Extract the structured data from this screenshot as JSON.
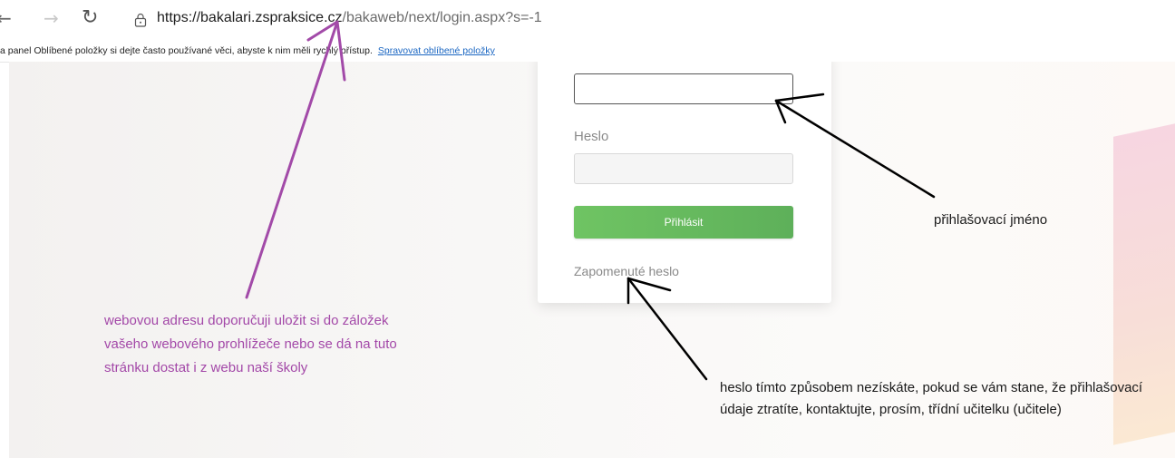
{
  "browser": {
    "url_domain": "https://bakalari.zspraksice.cz",
    "url_path": "/bakaweb/next/login.aspx?s=-1"
  },
  "favorites_bar": {
    "text": "a panel Oblíbené položky si dejte často používané věci, abyste k nim měli rychlý přístup.",
    "link": "Spravovat oblíbené položky"
  },
  "login_form": {
    "password_label": "Heslo",
    "login_button": "Přihlásit",
    "forgot_password": "Zapomenuté heslo"
  },
  "annotations": {
    "bookmark_tip": "webovou adresu doporučuji uložit si do záložek vašeho webového prohlížeče nebo se dá na tuto stránku dostat i z webu naší školy",
    "username_tip": "přihlašovací jméno",
    "password_tip": "heslo tímto způsobem nezískáte, pokud se vám stane, že přihlašovací údaje ztratíte, kontaktujte, prosím, třídní učitelku (učitele)",
    "colors": {
      "purple": "#a348a8",
      "black": "#000000"
    }
  },
  "icons": [
    "back-icon",
    "forward-icon",
    "refresh-icon",
    "lock-icon"
  ]
}
